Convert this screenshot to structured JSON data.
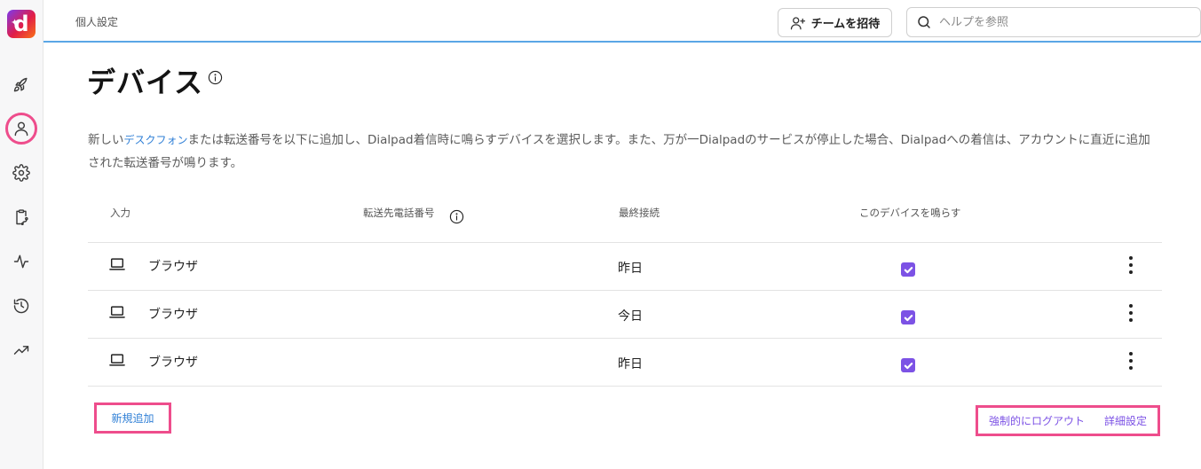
{
  "header": {
    "breadcrumb": "個人設定",
    "invite_label": "チームを招待",
    "search_placeholder": "ヘルプを参照"
  },
  "page": {
    "title": "デバイス",
    "description_before": "新しい",
    "description_link": "デスクフォン",
    "description_after": "または転送番号を以下に追加し、Dialpad着信時に鳴らすデバイスを選択します。また、万が一Dialpadのサービスが停止した場合、Dialpadへの着信は、アカウントに直近に追加された転送番号が鳴ります。"
  },
  "table": {
    "columns": [
      "入力",
      "転送先電話番号",
      "最終接続",
      "このデバイスを鳴らす"
    ],
    "rows": [
      {
        "input": "ブラウザ",
        "forward_number": "",
        "last_connected": "昨日",
        "ring": true
      },
      {
        "input": "ブラウザ",
        "forward_number": "",
        "last_connected": "今日",
        "ring": true
      },
      {
        "input": "ブラウザ",
        "forward_number": "",
        "last_connected": "昨日",
        "ring": true
      }
    ]
  },
  "actions": {
    "add_new": "新規追加",
    "force_logout": "強制的にログアウト",
    "advanced_settings": "詳細設定"
  },
  "colors": {
    "accent": "#7c52e5",
    "link": "#2f7fd6",
    "highlight": "#ee4d8c",
    "header_border": "#5aa6e6"
  }
}
